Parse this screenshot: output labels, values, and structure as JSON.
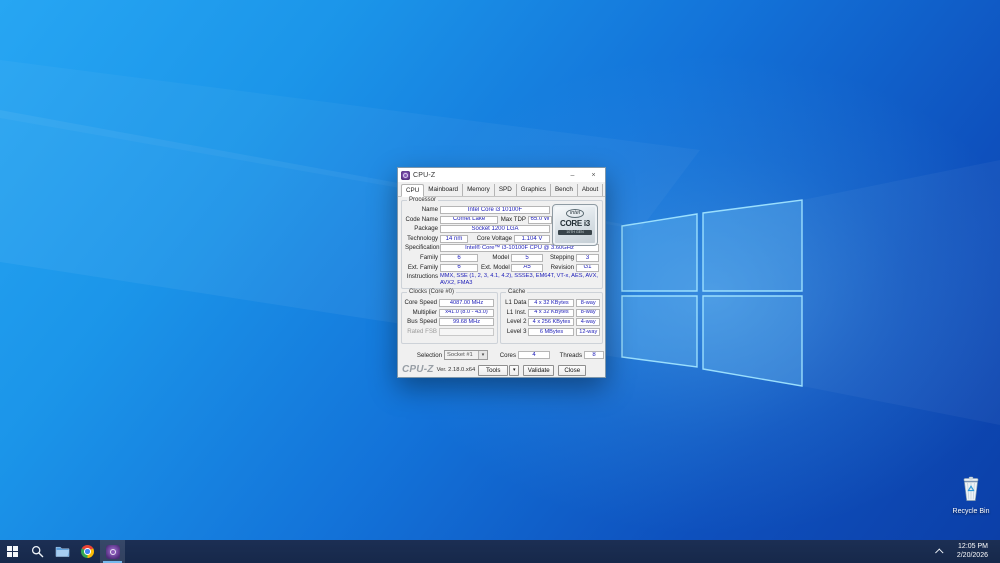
{
  "window": {
    "title": "CPU-Z",
    "controls": {
      "minimize": "–",
      "close": "×"
    },
    "tabs": [
      {
        "label": "CPU"
      },
      {
        "label": "Mainboard"
      },
      {
        "label": "Memory"
      },
      {
        "label": "SPD"
      },
      {
        "label": "Graphics"
      },
      {
        "label": "Bench"
      },
      {
        "label": "About"
      }
    ],
    "processor": {
      "group_label": "Processor",
      "name_label": "Name",
      "name_value": "Intel Core i3 10100F",
      "code_name_label": "Code Name",
      "code_name_value": "Comet Lake",
      "max_tdp_label": "Max TDP",
      "max_tdp_value": "65.0 W",
      "package_label": "Package",
      "package_value": "Socket 1200 LGA",
      "technology_label": "Technology",
      "technology_value": "14 nm",
      "core_voltage_label": "Core Voltage",
      "core_voltage_value": "1.104 V",
      "specification_label": "Specification",
      "specification_value": "Intel® Core™ i3-10100F CPU @ 3.60GHz",
      "family_label": "Family",
      "family_value": "6",
      "model_label": "Model",
      "model_value": "5",
      "stepping_label": "Stepping",
      "stepping_value": "3",
      "ext_family_label": "Ext. Family",
      "ext_family_value": "6",
      "ext_model_label": "Ext. Model",
      "ext_model_value": "A5",
      "revision_label": "Revision",
      "revision_value": "G1",
      "instructions_label": "Instructions",
      "instructions_value": "MMX, SSE (1, 2, 3, 4.1, 4.2), SSSE3, EM64T, VT-x, AES, AVX, AVX2, FMA3",
      "badge": {
        "brand": "intel",
        "product": "CORE i3",
        "generation": "10TH GEN"
      }
    },
    "clocks": {
      "group_label": "Clocks (Core #0)",
      "rows": [
        {
          "label": "Core Speed",
          "value": "4087.00 MHz"
        },
        {
          "label": "Multiplier",
          "value": "x41.0 (8.0 - 43.0)"
        },
        {
          "label": "Bus Speed",
          "value": "99.68 MHz"
        },
        {
          "label": "Rated FSB",
          "value": ""
        }
      ]
    },
    "cache": {
      "group_label": "Cache",
      "rows": [
        {
          "label": "L1 Data",
          "size": "4 x 32 KBytes",
          "assoc": "8-way"
        },
        {
          "label": "L1 Inst.",
          "size": "4 x 32 KBytes",
          "assoc": "8-way"
        },
        {
          "label": "Level 2",
          "size": "4 x 256 KBytes",
          "assoc": "4-way"
        },
        {
          "label": "Level 3",
          "size": "6 MBytes",
          "assoc": "12-way"
        }
      ]
    },
    "bottom": {
      "selection_label": "Selection",
      "selection_value": "Socket #1",
      "dropdown_arrow": "▾",
      "cores_label": "Cores",
      "cores_value": "4",
      "threads_label": "Threads",
      "threads_value": "8"
    },
    "footer": {
      "logo": "CPU-Z",
      "version": "Ver. 2.18.0.x64",
      "tools_label": "Tools",
      "tools_arrow": "▾",
      "validate_label": "Validate",
      "close_label": "Close"
    }
  },
  "desktop": {
    "recycle_bin_label": "Recycle Bin"
  },
  "taskbar": {
    "icons": [
      {
        "name": "start-icon"
      },
      {
        "name": "search-icon"
      },
      {
        "name": "file-explorer-icon"
      },
      {
        "name": "chrome-icon"
      },
      {
        "name": "cpuz-icon"
      }
    ],
    "tray": {
      "time": "12:05 PM",
      "date": "2/20/2026"
    }
  },
  "colors": {
    "field_text_blue": "#1a1ab8",
    "cpuz_purple": "#4d2a78",
    "taskbar_bg": "#16284a",
    "active_underline": "#76b9ed",
    "wallpaper_top": "#27a6f3",
    "wallpaper_bottom": "#0c3fa8"
  }
}
